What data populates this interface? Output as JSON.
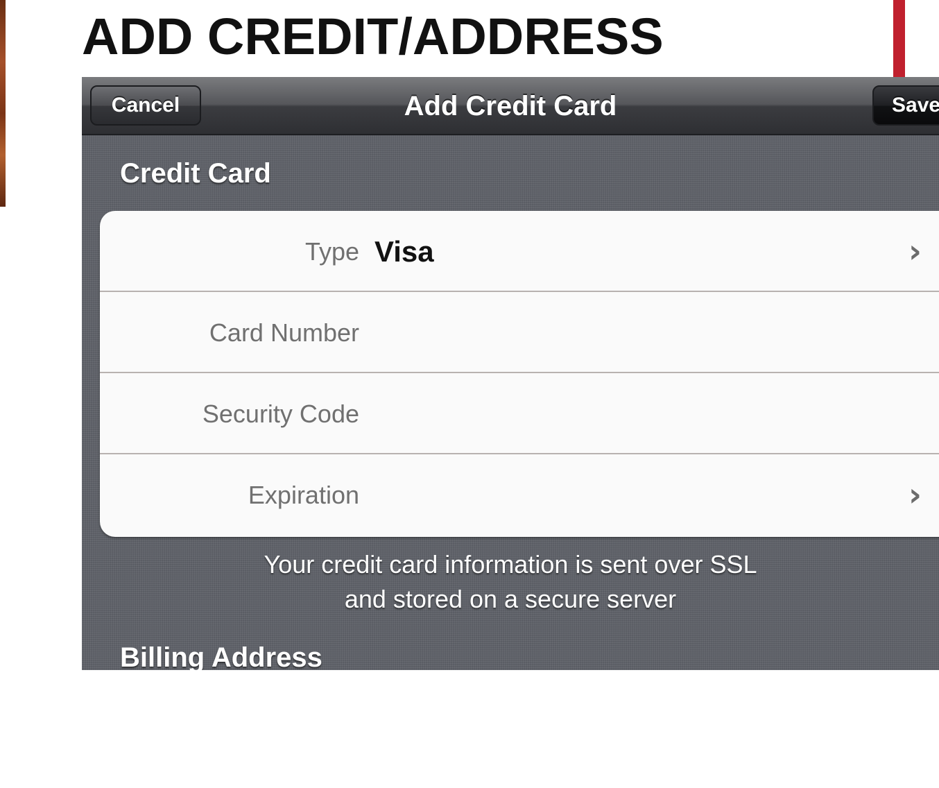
{
  "document": {
    "heading": "ADD CREDIT/ADDRESS"
  },
  "nav_bar": {
    "title": "Add Credit Card",
    "cancel_label": "Cancel",
    "save_label": "Save"
  },
  "sections": {
    "credit_card": {
      "header": "Credit Card",
      "rows": [
        {
          "label": "Type",
          "value": "Visa",
          "disclosure": true
        },
        {
          "label": "Card Number",
          "value": "",
          "disclosure": false
        },
        {
          "label": "Security Code",
          "value": "",
          "disclosure": false
        },
        {
          "label": "Expiration",
          "value": "",
          "disclosure": true
        }
      ],
      "footer_lines": [
        "Your credit card information is sent over SSL",
        "and stored on a secure server"
      ]
    },
    "billing_address": {
      "header": "Billing Address"
    }
  },
  "icons": {
    "disclosure": "chevron-right-icon"
  },
  "colors": {
    "accent_red": "#c0202e",
    "nav_bar": "#3b3c40",
    "background": "#5c5f66",
    "group_fill": "#fafafa"
  }
}
